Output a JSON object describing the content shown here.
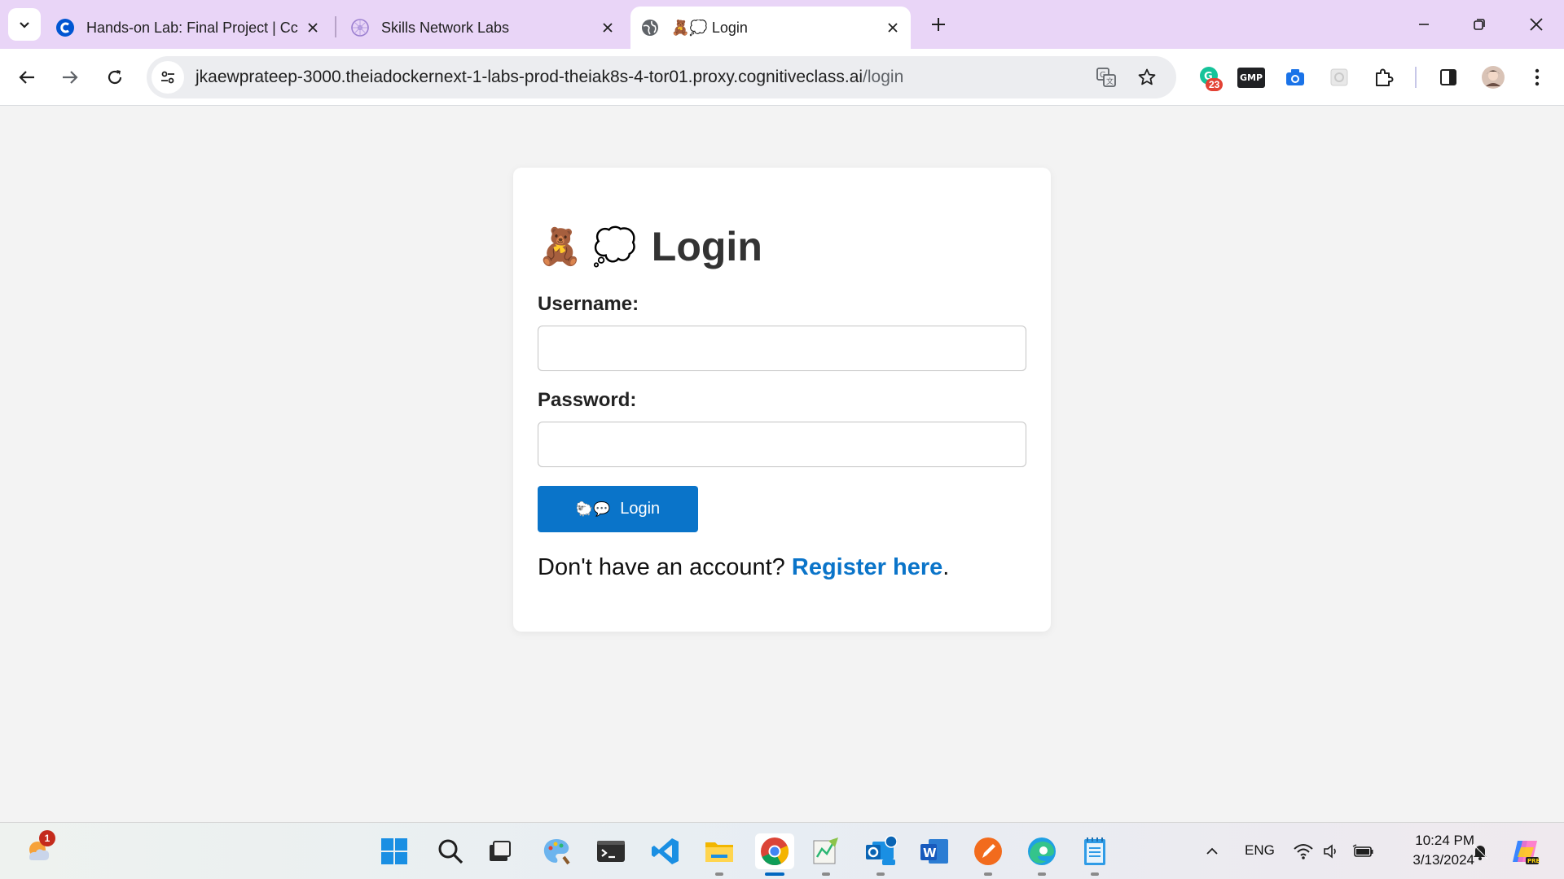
{
  "browser": {
    "tabs": [
      {
        "title": "Hands-on Lab: Final Project | Cc",
        "favicon": "coursera-icon",
        "active": false
      },
      {
        "title": "Skills Network Labs",
        "favicon": "skills-network-icon",
        "active": false
      },
      {
        "title": "🧸💭 Login",
        "favicon": "globe-icon",
        "active": true
      }
    ],
    "url_host": "jkaewprateep-3000.theiadockernext-1-labs-prod-theiak8s-4-tor01.proxy.cognitiveclass.ai",
    "url_path": "/login",
    "extension_badge": "23",
    "gmp_label": "GMP"
  },
  "page": {
    "heading_emoji": "🧸 💭",
    "heading": "Login",
    "username_label": "Username:",
    "username_value": "",
    "password_label": "Password:",
    "password_value": "",
    "login_button_emoji": "🐑💬",
    "login_button": "Login",
    "register_prompt": "Don't have an account?",
    "register_link": "Register here",
    "register_suffix": "."
  },
  "taskbar": {
    "weather_badge": "1",
    "language": "ENG",
    "time": "10:24 PM",
    "date": "3/13/2024"
  },
  "colors": {
    "tabstrip": "#e9d5f7",
    "accent": "#0a74c9",
    "page_bg": "#f3f3f3"
  }
}
